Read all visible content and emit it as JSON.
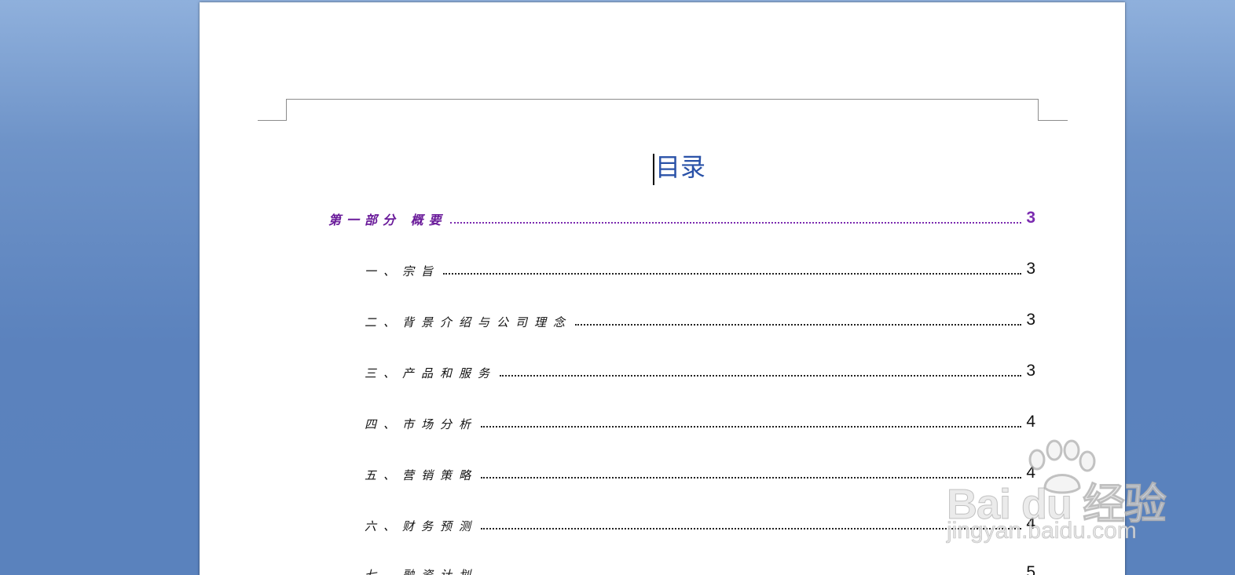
{
  "document": {
    "title": "目录",
    "toc": [
      {
        "level": 1,
        "label": "第一部分  概要",
        "page": "3"
      },
      {
        "level": 2,
        "label": "一、宗旨",
        "page": "3"
      },
      {
        "level": 2,
        "label": "二、背景介绍与公司理念",
        "page": "3"
      },
      {
        "level": 2,
        "label": "三、产品和服务",
        "page": "3"
      },
      {
        "level": 2,
        "label": "四、市场分析",
        "page": "4"
      },
      {
        "level": 2,
        "label": "五、营销策略",
        "page": "4"
      },
      {
        "level": 2,
        "label": "六、财务预测",
        "page": "4"
      },
      {
        "level": 2,
        "label": "七、融资计划",
        "page": "5"
      }
    ]
  },
  "watermark": {
    "brand": "Bai du 经验",
    "url": "jingyan.baidu.com"
  },
  "colors": {
    "title": "#2a52a8",
    "level1": "#6a1b9a",
    "background": "#5b82bd"
  }
}
